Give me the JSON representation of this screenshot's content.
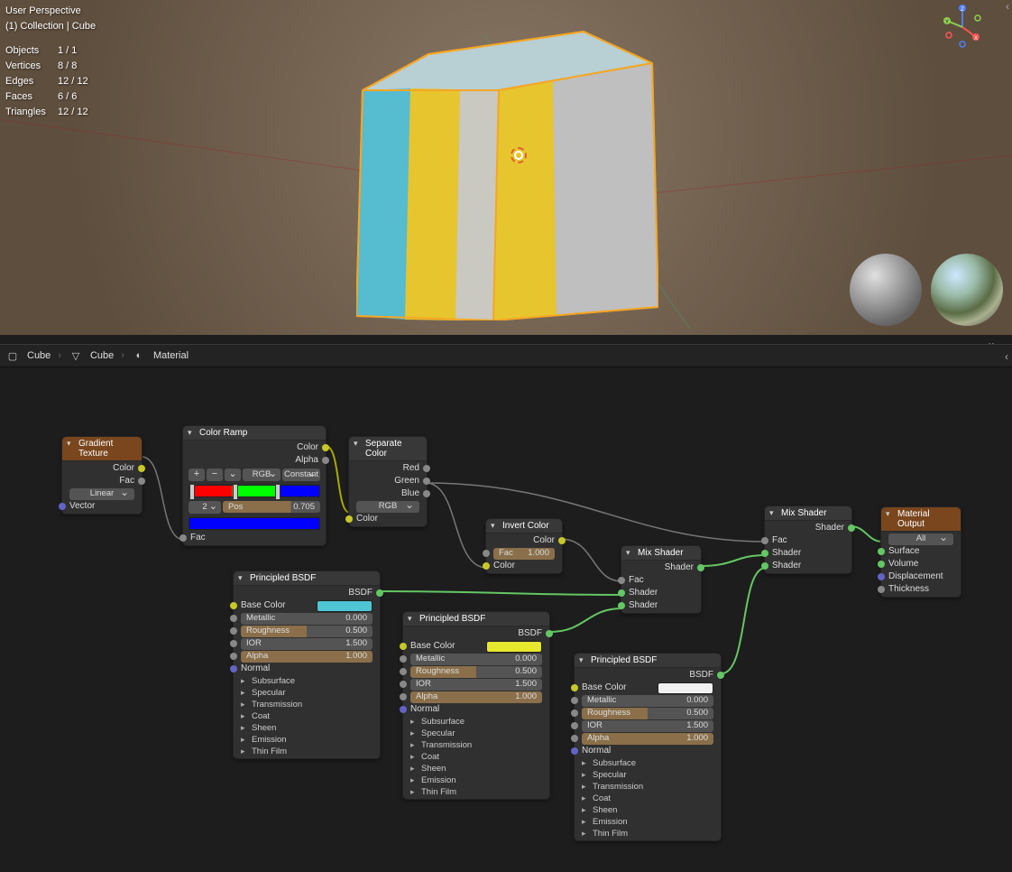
{
  "viewport": {
    "perspective_label": "User Perspective",
    "collection_label": "(1) Collection | Cube",
    "stats": {
      "Objects": "1 / 1",
      "Vertices": "8 / 8",
      "Edges": "12 / 12",
      "Faces": "6 / 6",
      "Triangles": "12 / 12"
    }
  },
  "breadcrumb": {
    "object": "Cube",
    "mesh": "Cube",
    "material": "Material"
  },
  "nodes": {
    "gradient": {
      "title": "Gradient Texture",
      "out_color": "Color",
      "out_fac": "Fac",
      "interp": "Linear",
      "in_vector": "Vector"
    },
    "ramp": {
      "title": "Color Ramp",
      "out_color": "Color",
      "out_alpha": "Alpha",
      "mode": "RGB",
      "interp": "Constant",
      "stop_index": "2",
      "pos_label": "Pos",
      "pos_value": "0.705",
      "in_fac": "Fac"
    },
    "sepcolor": {
      "title": "Separate Color",
      "out_r": "Red",
      "out_g": "Green",
      "out_b": "Blue",
      "mode": "RGB",
      "in_color": "Color"
    },
    "invert": {
      "title": "Invert Color",
      "out_color": "Color",
      "fac_label": "Fac",
      "fac_value": "1.000",
      "in_color": "Color"
    },
    "mix1": {
      "title": "Mix Shader",
      "out_shader": "Shader",
      "in_fac": "Fac",
      "in_shader1": "Shader",
      "in_shader2": "Shader"
    },
    "mix2": {
      "title": "Mix Shader",
      "out_shader": "Shader",
      "in_fac": "Fac",
      "in_shader1": "Shader",
      "in_shader2": "Shader"
    },
    "output": {
      "title": "Material Output",
      "target": "All",
      "in_surface": "Surface",
      "in_volume": "Volume",
      "in_disp": "Displacement",
      "in_thick": "Thickness"
    },
    "bsdf1": {
      "title": "Principled BSDF",
      "out": "BSDF",
      "base_color": "Base Color",
      "metallic_l": "Metallic",
      "metallic_v": "0.000",
      "rough_l": "Roughness",
      "rough_v": "0.500",
      "ior_l": "IOR",
      "ior_v": "1.500",
      "alpha_l": "Alpha",
      "alpha_v": "1.000",
      "normal": "Normal",
      "sections": [
        "Subsurface",
        "Specular",
        "Transmission",
        "Coat",
        "Sheen",
        "Emission",
        "Thin Film"
      ],
      "color": "#4fc6d4"
    },
    "bsdf2": {
      "title": "Principled BSDF",
      "out": "BSDF",
      "base_color": "Base Color",
      "metallic_l": "Metallic",
      "metallic_v": "0.000",
      "rough_l": "Roughness",
      "rough_v": "0.500",
      "ior_l": "IOR",
      "ior_v": "1.500",
      "alpha_l": "Alpha",
      "alpha_v": "1.000",
      "normal": "Normal",
      "sections": [
        "Subsurface",
        "Specular",
        "Transmission",
        "Coat",
        "Sheen",
        "Emission",
        "Thin Film"
      ],
      "color": "#e7c52e"
    },
    "bsdf3": {
      "title": "Principled BSDF",
      "out": "BSDF",
      "base_color": "Base Color",
      "metallic_l": "Metallic",
      "metallic_v": "0.000",
      "rough_l": "Roughness",
      "rough_v": "0.500",
      "ior_l": "IOR",
      "ior_v": "1.500",
      "alpha_l": "Alpha",
      "alpha_v": "1.000",
      "normal": "Normal",
      "sections": [
        "Subsurface",
        "Specular",
        "Transmission",
        "Coat",
        "Sheen",
        "Emission",
        "Thin Film"
      ],
      "color": "#f0f0f0"
    }
  }
}
